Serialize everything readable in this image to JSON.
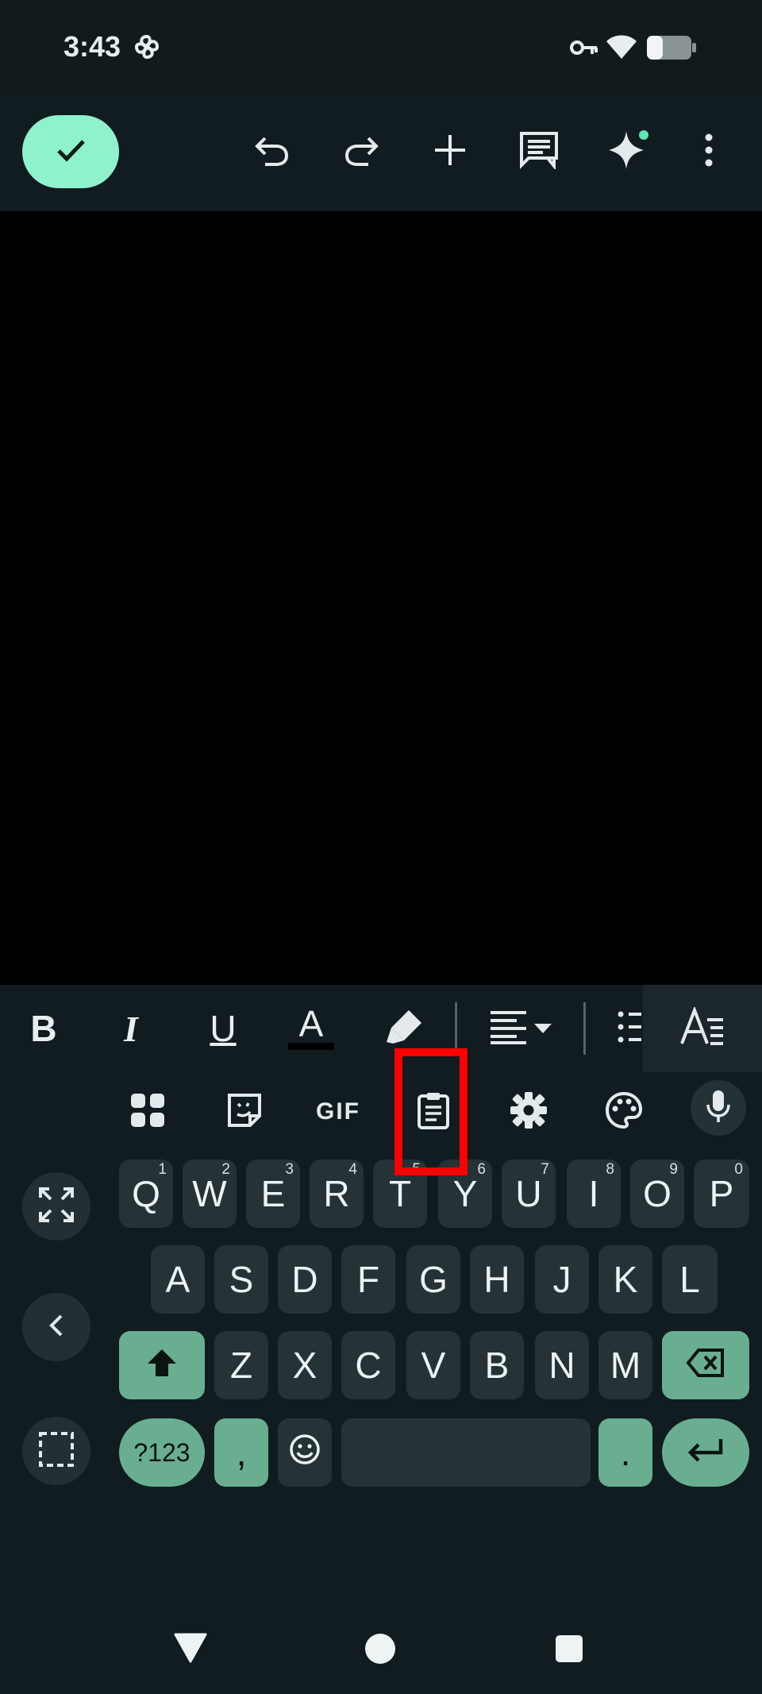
{
  "status_bar": {
    "time": "3:43",
    "icons": [
      "pinwheel-icon",
      "vpn-key-icon",
      "wifi-icon",
      "battery-icon"
    ]
  },
  "toolbar": {
    "done": "check-icon",
    "actions": [
      "undo-icon",
      "redo-icon",
      "add-icon",
      "comment-icon",
      "sparkle-icon",
      "more-vert-icon"
    ],
    "accent_color": "#8ef2cc"
  },
  "format_bar": {
    "bold": "B",
    "italic": "I",
    "underline": "U",
    "text_color": "A",
    "items": [
      "bold-icon",
      "italic-icon",
      "underline-icon",
      "text-color-icon",
      "highlighter-icon",
      "align-icon",
      "bullet-list-icon",
      "text-style-icon"
    ]
  },
  "keyboard_tools": {
    "gif": "GIF",
    "items": [
      "apps-grid-icon",
      "sticker-icon",
      "gif-icon",
      "clipboard-icon",
      "settings-icon",
      "palette-icon",
      "mic-icon"
    ]
  },
  "keyboard": {
    "row1": [
      {
        "key": "Q",
        "hint": "1"
      },
      {
        "key": "W",
        "hint": "2"
      },
      {
        "key": "E",
        "hint": "3"
      },
      {
        "key": "R",
        "hint": "4"
      },
      {
        "key": "T",
        "hint": "5"
      },
      {
        "key": "Y",
        "hint": "6"
      },
      {
        "key": "U",
        "hint": "7"
      },
      {
        "key": "I",
        "hint": "8"
      },
      {
        "key": "O",
        "hint": "9"
      },
      {
        "key": "P",
        "hint": "0"
      }
    ],
    "row2": [
      "A",
      "S",
      "D",
      "F",
      "G",
      "H",
      "J",
      "K",
      "L"
    ],
    "row3": [
      "Z",
      "X",
      "C",
      "V",
      "B",
      "N",
      "M"
    ],
    "symbols": "?123",
    "comma": ",",
    "period": ".",
    "accent_key_color": "#6aae92"
  },
  "nav_bar": [
    "back-icon",
    "home-icon",
    "recents-icon"
  ],
  "annotation": {
    "color": "#ff0000"
  }
}
